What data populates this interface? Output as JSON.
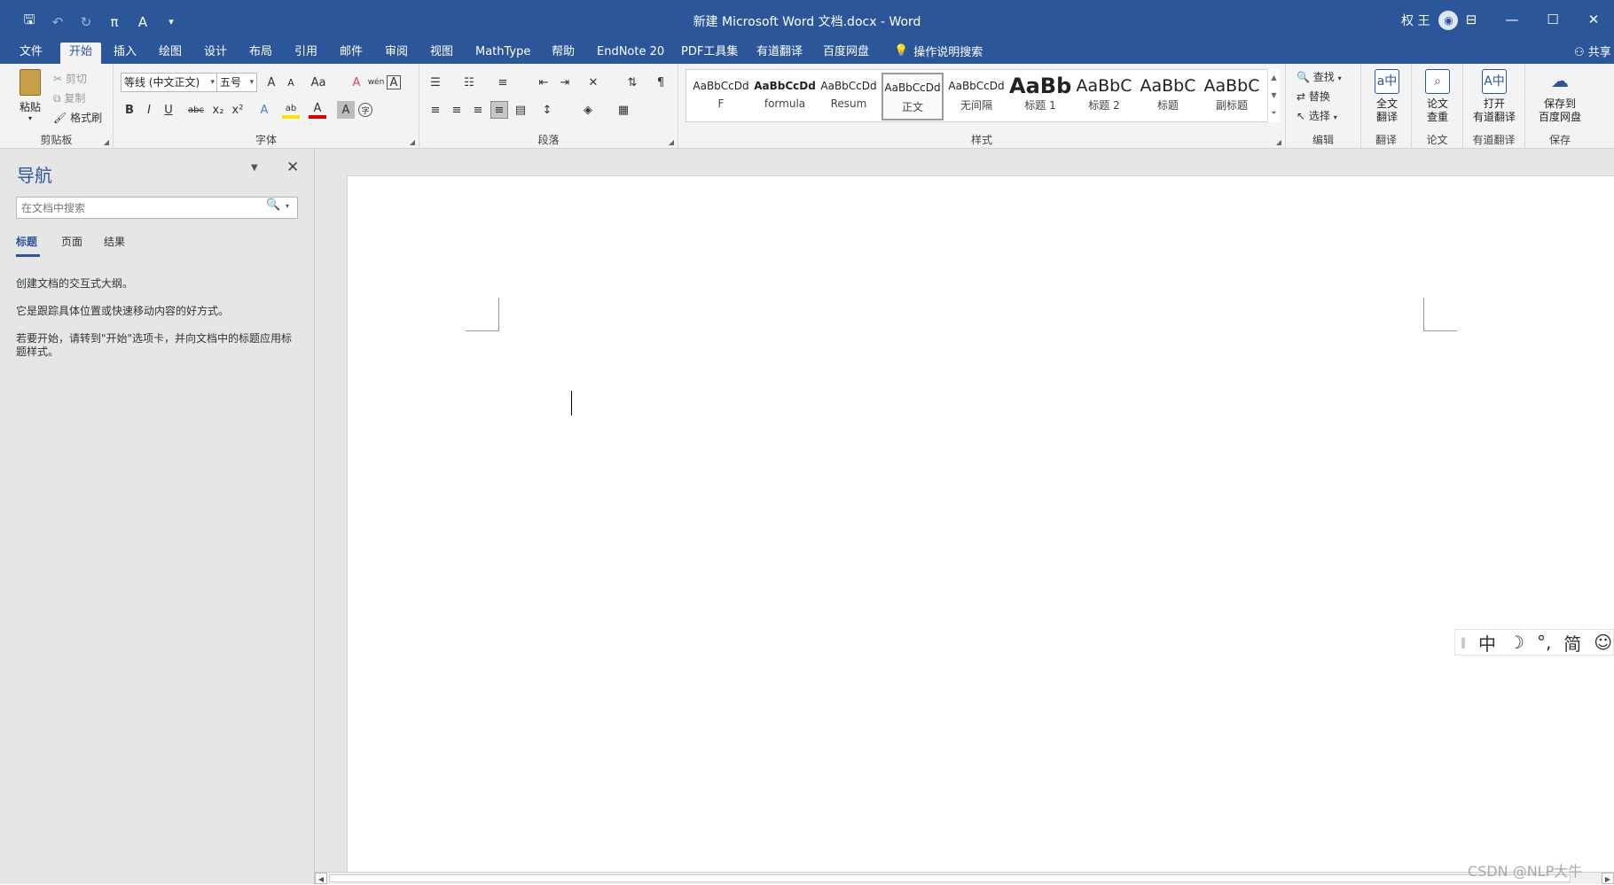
{
  "titlebar": {
    "title": "新建 Microsoft Word 文档.docx  -  Word",
    "user_name": "权 王",
    "qat": {
      "save": "🖫",
      "undo": "↶",
      "redo": "↻",
      "equation": "π",
      "format": "A",
      "customize": "▾"
    },
    "window_buttons": {
      "ribbon_display": "⊟",
      "minimize": "—",
      "maximize": "☐",
      "close": "✕"
    }
  },
  "tabs": [
    {
      "label": "文件"
    },
    {
      "label": "开始"
    },
    {
      "label": "插入"
    },
    {
      "label": "绘图"
    },
    {
      "label": "设计"
    },
    {
      "label": "布局"
    },
    {
      "label": "引用"
    },
    {
      "label": "邮件"
    },
    {
      "label": "审阅"
    },
    {
      "label": "视图"
    },
    {
      "label": "MathType"
    },
    {
      "label": "帮助"
    },
    {
      "label": "EndNote 20"
    },
    {
      "label": "PDF工具集"
    },
    {
      "label": "有道翻译"
    },
    {
      "label": "百度网盘"
    }
  ],
  "active_tab": "开始",
  "tell_me": "操作说明搜索",
  "share": "共享",
  "ribbon": {
    "clipboard": {
      "paste": "粘贴",
      "cut": "剪切",
      "copy": "复制",
      "format_painter": "格式刷",
      "label": "剪贴板"
    },
    "font": {
      "font_name": "等线 (中文正文)",
      "font_size": "五号",
      "grow": "A",
      "shrink": "A",
      "case": "Aa",
      "clear": "A",
      "pinyin": "wén",
      "border": "A",
      "bold": "B",
      "italic": "I",
      "underline": "U",
      "strike": "abc",
      "sub": "x₂",
      "sup": "x²",
      "effects": "A",
      "highlight": "ab",
      "color": "A",
      "shading": "A",
      "enclose": "字",
      "label": "字体"
    },
    "paragraph": {
      "label": "段落"
    },
    "styles": {
      "items": [
        {
          "preview": "AaBbCcDd",
          "name": "F"
        },
        {
          "preview": "AaBbCcDd",
          "name": "formula"
        },
        {
          "preview": "AaBbCcDd",
          "name": "Resum"
        },
        {
          "preview": "AaBbCcDd",
          "name": "正文"
        },
        {
          "preview": "AaBbCcDd",
          "name": "无间隔"
        },
        {
          "preview": "AaBb",
          "name": "标题 1"
        },
        {
          "preview": "AaBbC",
          "name": "标题 2"
        },
        {
          "preview": "AaBbC",
          "name": "标题"
        },
        {
          "preview": "AaBbC",
          "name": "副标题"
        }
      ],
      "label": "样式"
    },
    "editing": {
      "find": "查找",
      "replace": "替换",
      "select": "选择",
      "label": "编辑"
    },
    "translate": {
      "button": "全文\n翻译",
      "label": "翻译"
    },
    "thesis": {
      "button": "论文\n查重",
      "label": "论文"
    },
    "youdao": {
      "button": "打开\n有道翻译",
      "label": "有道翻译"
    },
    "baidu": {
      "button": "保存到\n百度网盘",
      "label": "保存"
    }
  },
  "nav": {
    "title": "导航",
    "search_placeholder": "在文档中搜索",
    "tabs": [
      {
        "label": "标题"
      },
      {
        "label": "页面"
      },
      {
        "label": "结果"
      }
    ],
    "text1": "创建文档的交互式大纲。",
    "text2": "它是跟踪具体位置或快速移动内容的好方式。",
    "text3": "若要开始，请转到\"开始\"选项卡，并向文档中的标题应用标题样式。"
  },
  "ime": {
    "mode": "中",
    "moon": "☽",
    "punct": "°,",
    "simplified": "简",
    "emoji": "☺"
  },
  "watermark": "CSDN @NLP大牛"
}
